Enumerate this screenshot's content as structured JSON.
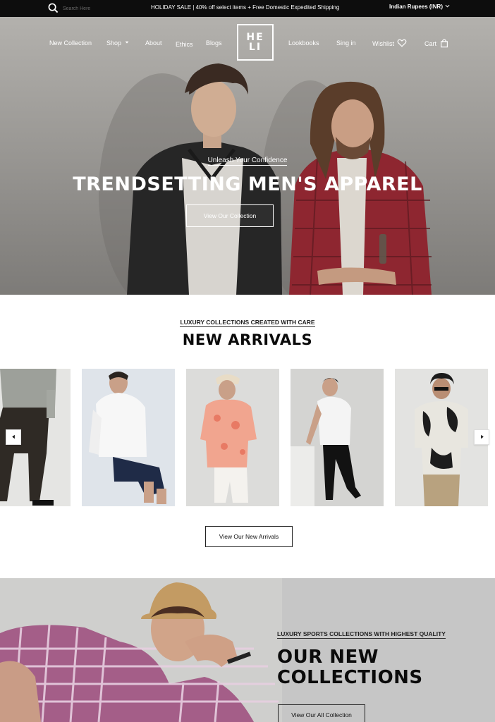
{
  "topbar": {
    "search_placeholder": "Search Here",
    "promo": "HOLIDAY SALE | 40% off select items + Free Domestic Expedited Shipping",
    "currency": "Indian Rupees (INR)"
  },
  "nav": {
    "new_collection": "New Collection",
    "shop": "Shop",
    "about": "About",
    "ethics": "Ethics",
    "blogs": "Blogs",
    "logo_line1": "HE",
    "logo_line2": "LI",
    "lookbooks": "Lookbooks",
    "sign_in": "Sing in",
    "wishlist": "Wishlist",
    "cart": "Cart"
  },
  "hero": {
    "kicker": "Unleash Your Confidence",
    "headline": "TRENDSETTING MEN'S APPAREL",
    "cta": "View Our Collection"
  },
  "arrivals": {
    "kicker": "LUXURY COLLECTIONS CREATED WITH CARE",
    "title": "NEW ARRIVALS",
    "cta": "View Our New Arrivals"
  },
  "collections": {
    "kicker": "LUXURY SPORTS COLLECTIONS WITH HIGHEST QUALITY",
    "title_line1": "OUR NEW",
    "title_line2": "COLLECTIONS",
    "cta": "View Our All Collection"
  },
  "colors": {
    "topbar_bg": "#0d0d0d",
    "collections_bg": "#c6c6c6",
    "text": "#111111"
  }
}
